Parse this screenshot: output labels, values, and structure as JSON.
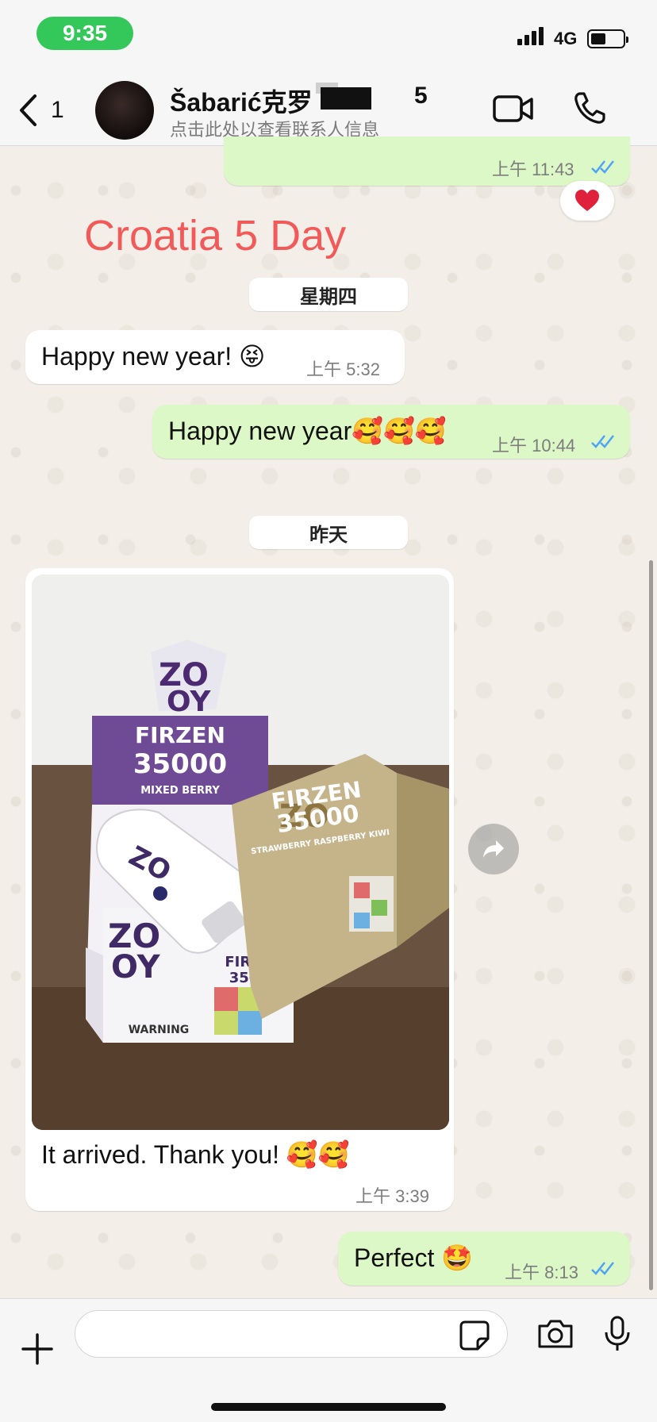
{
  "status_bar": {
    "time": "9:35",
    "network": "4G"
  },
  "header": {
    "back_count": "1",
    "contact_name": "Šabarić克罗",
    "contact_name_tail": "5",
    "contact_subtitle": "点击此处以查看联系人信息"
  },
  "overlay_title": "Croatia 5 Day",
  "messages": [
    {
      "direction": "out",
      "text": "",
      "time": "上午 11:43",
      "reaction": "❤️"
    },
    {
      "direction": "in",
      "text": "Happy new year! 😝",
      "time": "上午 5:32"
    },
    {
      "direction": "out",
      "text": "Happy new year🥰🥰🥰",
      "time": "上午 10:44"
    },
    {
      "direction": "in",
      "caption": "It arrived. Thank you! 🥰🥰",
      "time": "上午 3:39"
    },
    {
      "direction": "out",
      "text": "Perfect 🤩",
      "time": "上午 8:13"
    }
  ],
  "date_dividers": [
    "星期四",
    "昨天"
  ],
  "photo": {
    "brand": "ZO OY",
    "product": "FIRZEN",
    "puffs": "35000",
    "flavor_left": "MIXED BERRY",
    "flavor_right": "STRAWBERRY RASPBERRY KIWI",
    "warning": "WARNING"
  },
  "composer": {
    "placeholder": ""
  },
  "colors": {
    "outgoing_bubble": "#dcf8c6",
    "incoming_bubble": "#ffffff",
    "status_pill": "#34c759",
    "overlay_title": "#f25a5a",
    "read_ticks": "#4fa3f7"
  }
}
